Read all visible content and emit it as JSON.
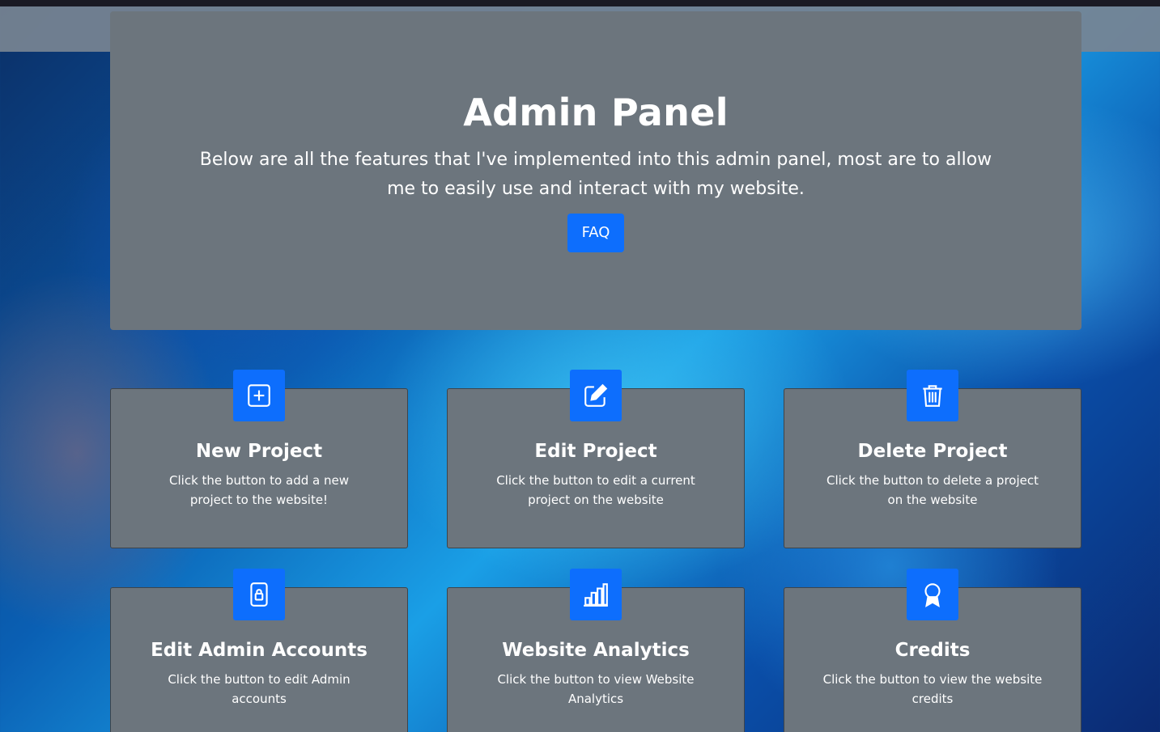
{
  "hero": {
    "title": "Admin Panel",
    "subtitle": "Below are all the features that I've implemented into this admin panel, most are to allow me to easily use and interact with my website.",
    "faq_label": "FAQ"
  },
  "cards": [
    {
      "icon": "plus-square-icon",
      "title": "New Project",
      "description": "Click the button to add a new project to the website!"
    },
    {
      "icon": "pencil-square-icon",
      "title": "Edit Project",
      "description": "Click the button to edit a current project on the website"
    },
    {
      "icon": "trash-icon",
      "title": "Delete Project",
      "description": "Click the button to delete a project on the website"
    },
    {
      "icon": "lock-icon",
      "title": "Edit Admin Accounts",
      "description": "Click the button to edit Admin accounts"
    },
    {
      "icon": "bar-chart-icon",
      "title": "Website Analytics",
      "description": "Click the button to view Website Analytics"
    },
    {
      "icon": "award-icon",
      "title": "Credits",
      "description": "Click the button to view the website credits"
    }
  ],
  "colors": {
    "primary": "#0d6efd",
    "panel": "#6c757d",
    "text": "#ffffff"
  }
}
